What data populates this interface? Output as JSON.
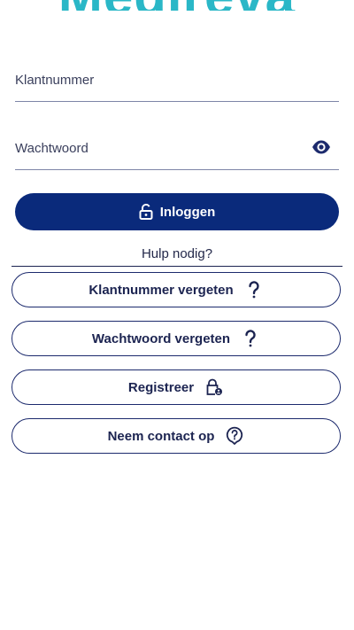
{
  "colors": {
    "brand_teal": "#2ab7c7",
    "primary_navy": "#0a2a7b",
    "text_navy": "#1c2451"
  },
  "logo": {
    "text": "Medireva"
  },
  "form": {
    "customer_number_placeholder": "Klantnummer",
    "password_placeholder": "Wachtwoord",
    "show_password_icon": "eye-icon"
  },
  "login_button": {
    "label": "Inloggen",
    "icon": "unlock-icon"
  },
  "help": {
    "heading": "Hulp nodig?"
  },
  "help_buttons": [
    {
      "label": "Klantnummer vergeten",
      "icon": "question-icon"
    },
    {
      "label": "Wachtwoord vergeten",
      "icon": "question-icon"
    },
    {
      "label": "Registreer",
      "icon": "lock-person-icon"
    },
    {
      "label": "Neem contact op",
      "icon": "question-circle-icon"
    }
  ]
}
